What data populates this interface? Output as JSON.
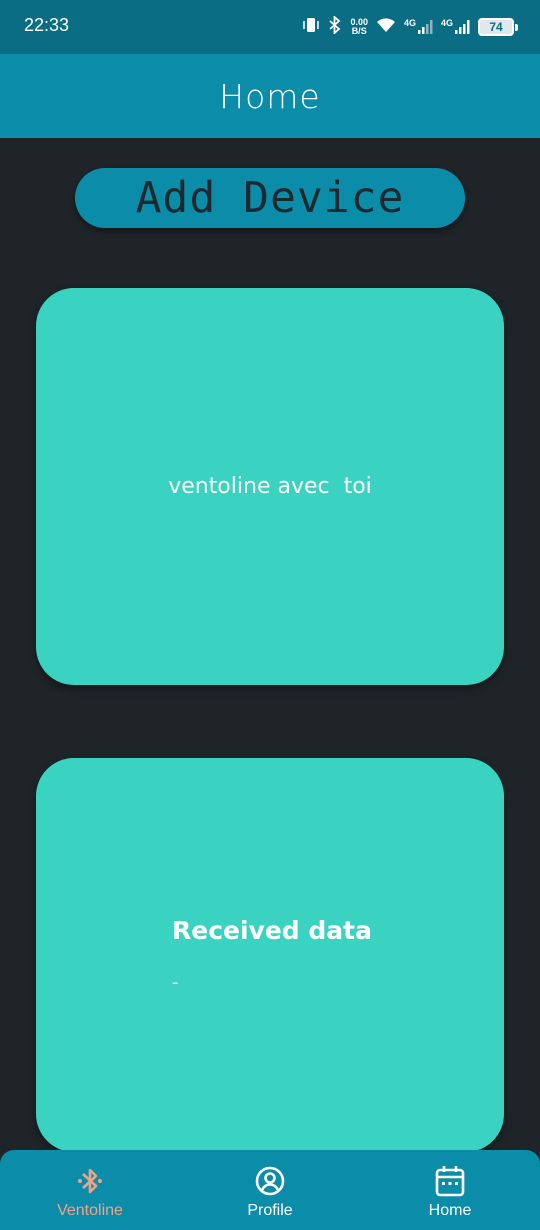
{
  "status_bar": {
    "time": "22:33",
    "net_speed_value": "0.00",
    "net_speed_unit": "B/S",
    "sim1": "4G",
    "sim2": "4G",
    "battery": "74"
  },
  "header": {
    "title": "Home"
  },
  "add_device": {
    "label": "Add Device"
  },
  "cards": {
    "device_name": "ventoline avec  toi",
    "received_title": "Received data",
    "received_value": "-"
  },
  "nav": {
    "items": [
      {
        "label": "Ventoline",
        "icon": "bluetooth-icon",
        "active": true
      },
      {
        "label": "Profile",
        "icon": "profile-icon",
        "active": false
      },
      {
        "label": "Home",
        "icon": "calendar-icon",
        "active": false
      }
    ],
    "active_color": "#f0a28a",
    "inactive_color": "#ffffff"
  },
  "colors": {
    "status_bar": "#0a6d84",
    "header": "#0b8daa",
    "background": "#1f2428",
    "card": "#3ad3c2"
  }
}
